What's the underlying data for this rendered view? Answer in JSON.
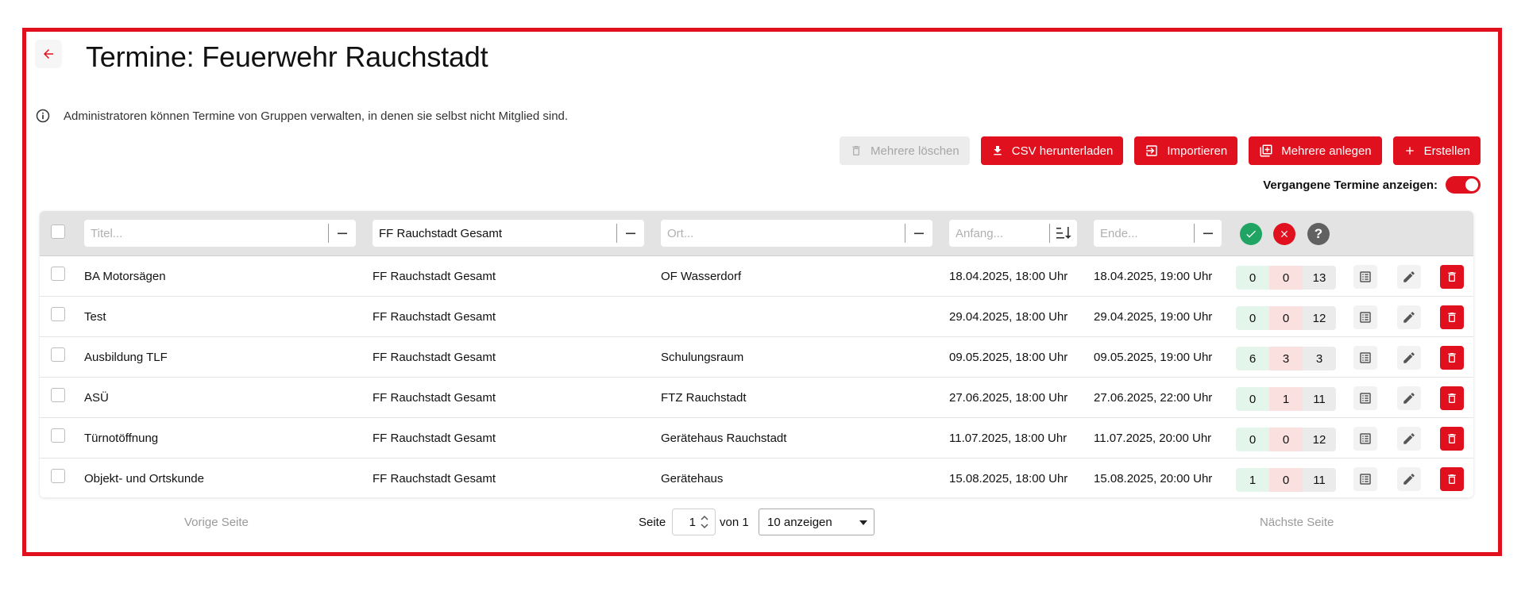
{
  "header": {
    "title": "Termine: Feuerwehr Rauchstadt",
    "info": "Administratoren können Termine von Gruppen verwalten, in denen sie selbst nicht Mitglied sind."
  },
  "toolbar": {
    "delete_many": "Mehrere löschen",
    "csv": "CSV herunterladen",
    "import": "Importieren",
    "create_many": "Mehrere anlegen",
    "create": "Erstellen",
    "show_past_label": "Vergangene Termine anzeigen:",
    "show_past": true
  },
  "filters": {
    "title_placeholder": "Titel...",
    "group_value": "FF Rauchstadt Gesamt",
    "place_placeholder": "Ort...",
    "start_placeholder": "Anfang...",
    "end_placeholder": "Ende..."
  },
  "status_icons": {
    "yes": "check-icon",
    "no": "cross-icon",
    "maybe": "question-icon"
  },
  "rows": [
    {
      "title": "BA Motorsägen",
      "group": "FF Rauchstadt Gesamt",
      "place": "OF Wasserdorf",
      "start": "18.04.2025, 18:00 Uhr",
      "end": "18.04.2025, 19:00 Uhr",
      "yes": "0",
      "no": "0",
      "maybe": "13"
    },
    {
      "title": "Test",
      "group": "FF Rauchstadt Gesamt",
      "place": "",
      "start": "29.04.2025, 18:00 Uhr",
      "end": "29.04.2025, 19:00 Uhr",
      "yes": "0",
      "no": "0",
      "maybe": "12"
    },
    {
      "title": "Ausbildung TLF",
      "group": "FF Rauchstadt Gesamt",
      "place": "Schulungsraum",
      "start": "09.05.2025, 18:00 Uhr",
      "end": "09.05.2025, 19:00 Uhr",
      "yes": "6",
      "no": "3",
      "maybe": "3"
    },
    {
      "title": "ASÜ",
      "group": "FF Rauchstadt Gesamt",
      "place": "FTZ Rauchstadt",
      "start": "27.06.2025, 18:00 Uhr",
      "end": "27.06.2025, 22:00 Uhr",
      "yes": "0",
      "no": "1",
      "maybe": "11"
    },
    {
      "title": "Türnotöffnung",
      "group": "FF Rauchstadt Gesamt",
      "place": "Gerätehaus Rauchstadt",
      "start": "11.07.2025, 18:00 Uhr",
      "end": "11.07.2025, 20:00 Uhr",
      "yes": "0",
      "no": "0",
      "maybe": "12"
    },
    {
      "title": "Objekt- und Ortskunde",
      "group": "FF Rauchstadt Gesamt",
      "place": "Gerätehaus",
      "start": "15.08.2025, 18:00 Uhr",
      "end": "15.08.2025, 20:00 Uhr",
      "yes": "1",
      "no": "0",
      "maybe": "11"
    }
  ],
  "pagination": {
    "prev": "Vorige Seite",
    "next": "Nächste Seite",
    "page_label": "Seite",
    "page": "1",
    "of_label": "von 1",
    "per_page": "10 anzeigen"
  },
  "colors": {
    "accent": "#e0101e",
    "yes": "#1fa463",
    "no": "#e0101e",
    "maybe": "#616161"
  }
}
